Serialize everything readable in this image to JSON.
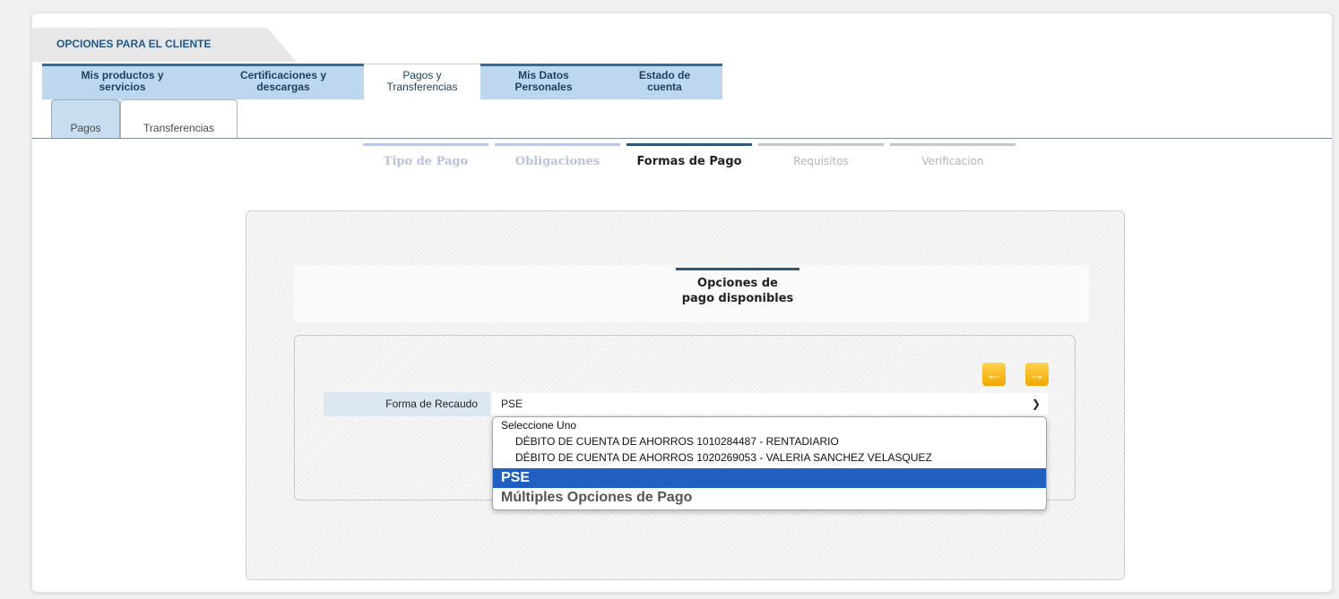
{
  "top_tab": {
    "label": "OPCIONES PARA EL CLIENTE"
  },
  "main_tabs": [
    {
      "label": "Mis productos y\nservicios"
    },
    {
      "label": "Certificaciones y\ndescargas"
    },
    {
      "label": "Pagos y\nTransferencias"
    },
    {
      "label": "Mis Datos\nPersonales"
    },
    {
      "label": "Estado de\ncuenta"
    }
  ],
  "sub_tabs": [
    {
      "label": "Pagos"
    },
    {
      "label": "Transferencias"
    }
  ],
  "steps": [
    {
      "label": "Tipo de Pago"
    },
    {
      "label": "Obligaciones"
    },
    {
      "label": "Formas de Pago"
    },
    {
      "label": "Requisitos"
    },
    {
      "label": "Verificacion"
    }
  ],
  "section_heading": "Opciones de\npago disponibles",
  "nav": {
    "prev_icon": "arrow-left-icon",
    "next_icon": "arrow-right-icon"
  },
  "form": {
    "label": "Forma de Recaudo",
    "selected_value": "PSE",
    "options": [
      "Seleccione Uno",
      "DÉBITO DE CUENTA DE AHORROS 1010284487 - RENTADIARIO",
      "DÉBITO DE CUENTA DE AHORROS 1020269053 - VALERIA SANCHEZ VELASQUEZ",
      "PSE",
      "Múltiples Opciones de Pago"
    ]
  },
  "colors": {
    "accent": "#2b6da4",
    "tab_bg": "#bdd8ee",
    "selected": "#1f5fbf",
    "nav_button": "#f5b400"
  }
}
